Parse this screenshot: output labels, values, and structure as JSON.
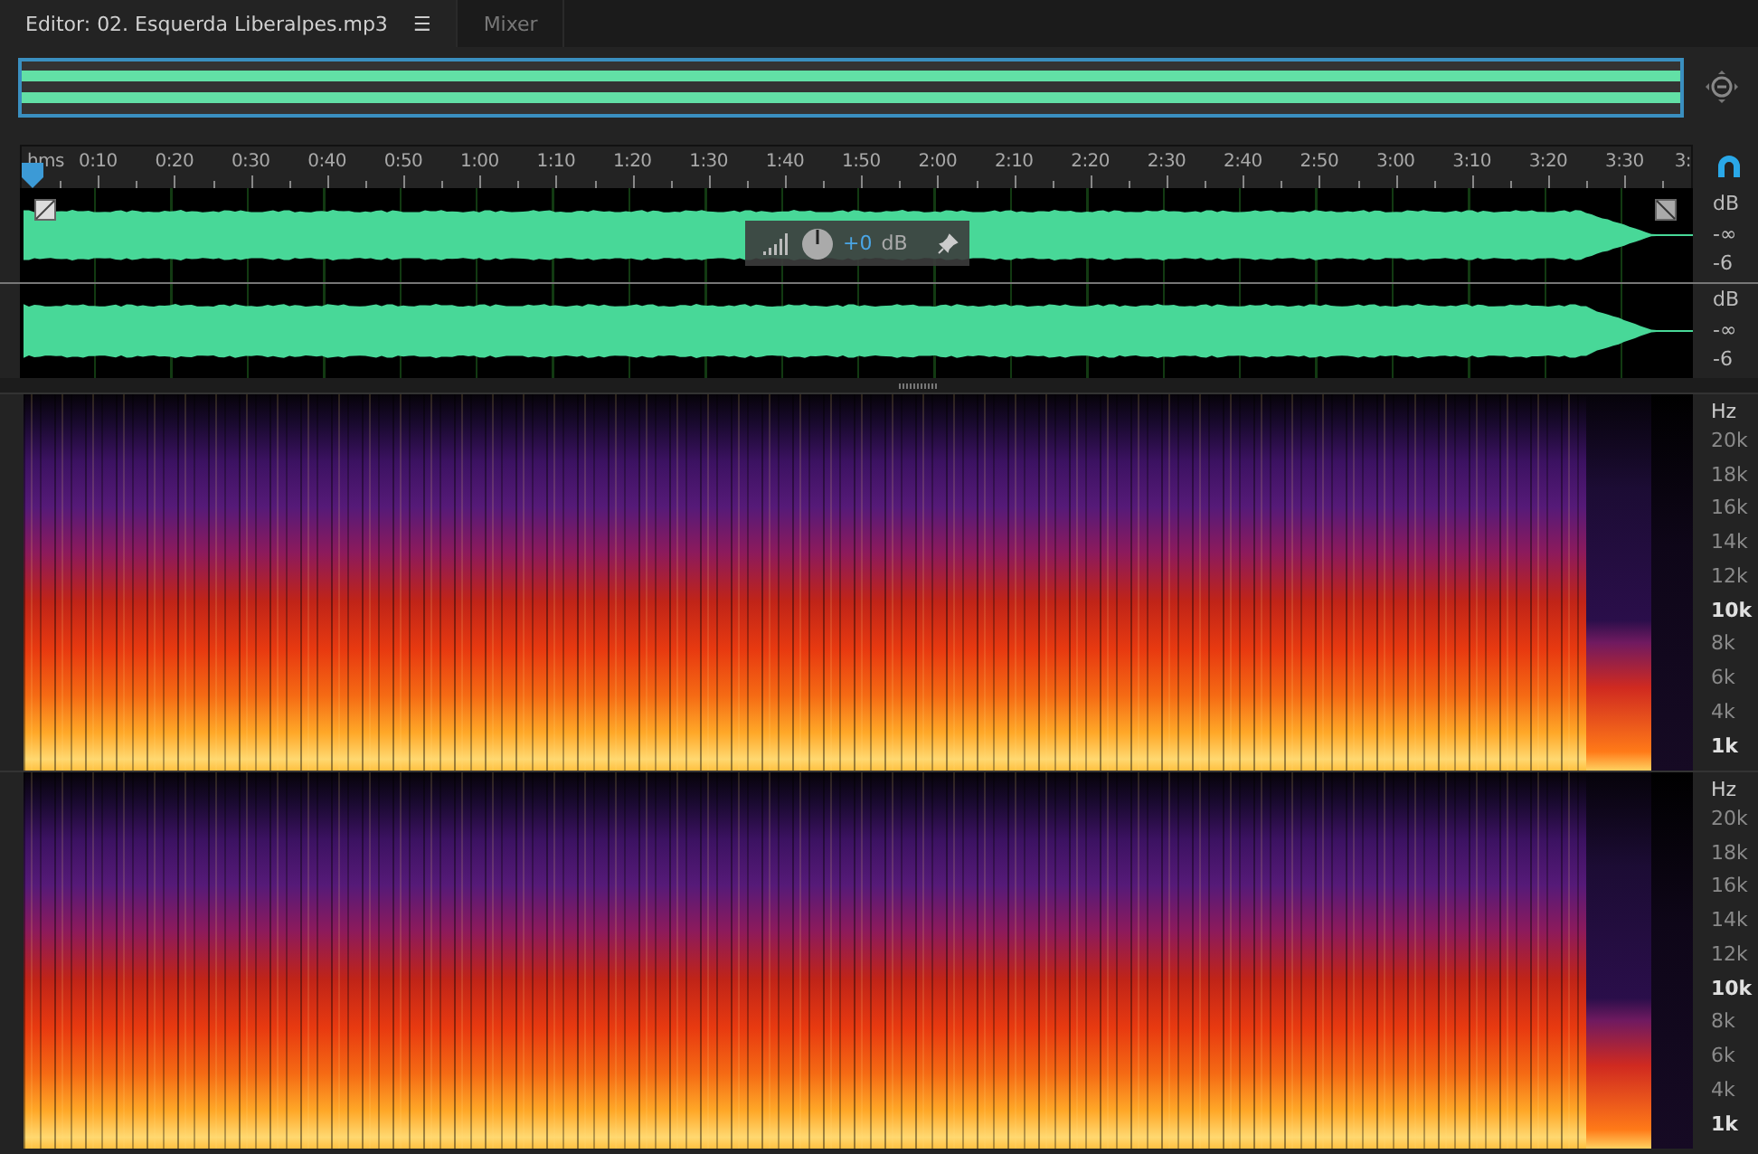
{
  "tabs": [
    {
      "label": "Editor: 02. Esquerda Liberalpes.mp3",
      "selected": true,
      "menu": "☰"
    },
    {
      "label": "Mixer",
      "selected": false
    }
  ],
  "ruler": {
    "labels": [
      "hms",
      "0:10",
      "0:20",
      "0:30",
      "0:40",
      "0:50",
      "1:00",
      "1:10",
      "1:20",
      "1:30",
      "1:40",
      "1:50",
      "2:00",
      "2:10",
      "2:20",
      "2:30",
      "2:40",
      "2:50",
      "3:00",
      "3:10",
      "3:20",
      "3:30",
      "3:"
    ]
  },
  "hud": {
    "value": "+0",
    "unit": "dB"
  },
  "channels": [
    {
      "scale": [
        "dB",
        "-∞",
        "-6"
      ]
    },
    {
      "scale": [
        "dB",
        "-∞",
        "-6"
      ]
    }
  ],
  "spectrograms": [
    {
      "unit": "Hz",
      "labels": [
        {
          "text": "20k",
          "emphasized": false
        },
        {
          "text": "18k",
          "emphasized": false
        },
        {
          "text": "16k",
          "emphasized": false
        },
        {
          "text": "14k",
          "emphasized": false
        },
        {
          "text": "12k",
          "emphasized": false
        },
        {
          "text": "10k",
          "emphasized": true
        },
        {
          "text": "8k",
          "emphasized": false
        },
        {
          "text": "6k",
          "emphasized": false
        },
        {
          "text": "4k",
          "emphasized": false
        },
        {
          "text": "1k",
          "emphasized": true
        }
      ]
    },
    {
      "unit": "Hz",
      "labels": [
        {
          "text": "20k",
          "emphasized": false
        },
        {
          "text": "18k",
          "emphasized": false
        },
        {
          "text": "16k",
          "emphasized": false
        },
        {
          "text": "14k",
          "emphasized": false
        },
        {
          "text": "12k",
          "emphasized": false
        },
        {
          "text": "10k",
          "emphasized": true
        },
        {
          "text": "8k",
          "emphasized": false
        },
        {
          "text": "6k",
          "emphasized": false
        },
        {
          "text": "4k",
          "emphasized": false
        },
        {
          "text": "1k",
          "emphasized": true
        }
      ]
    }
  ]
}
